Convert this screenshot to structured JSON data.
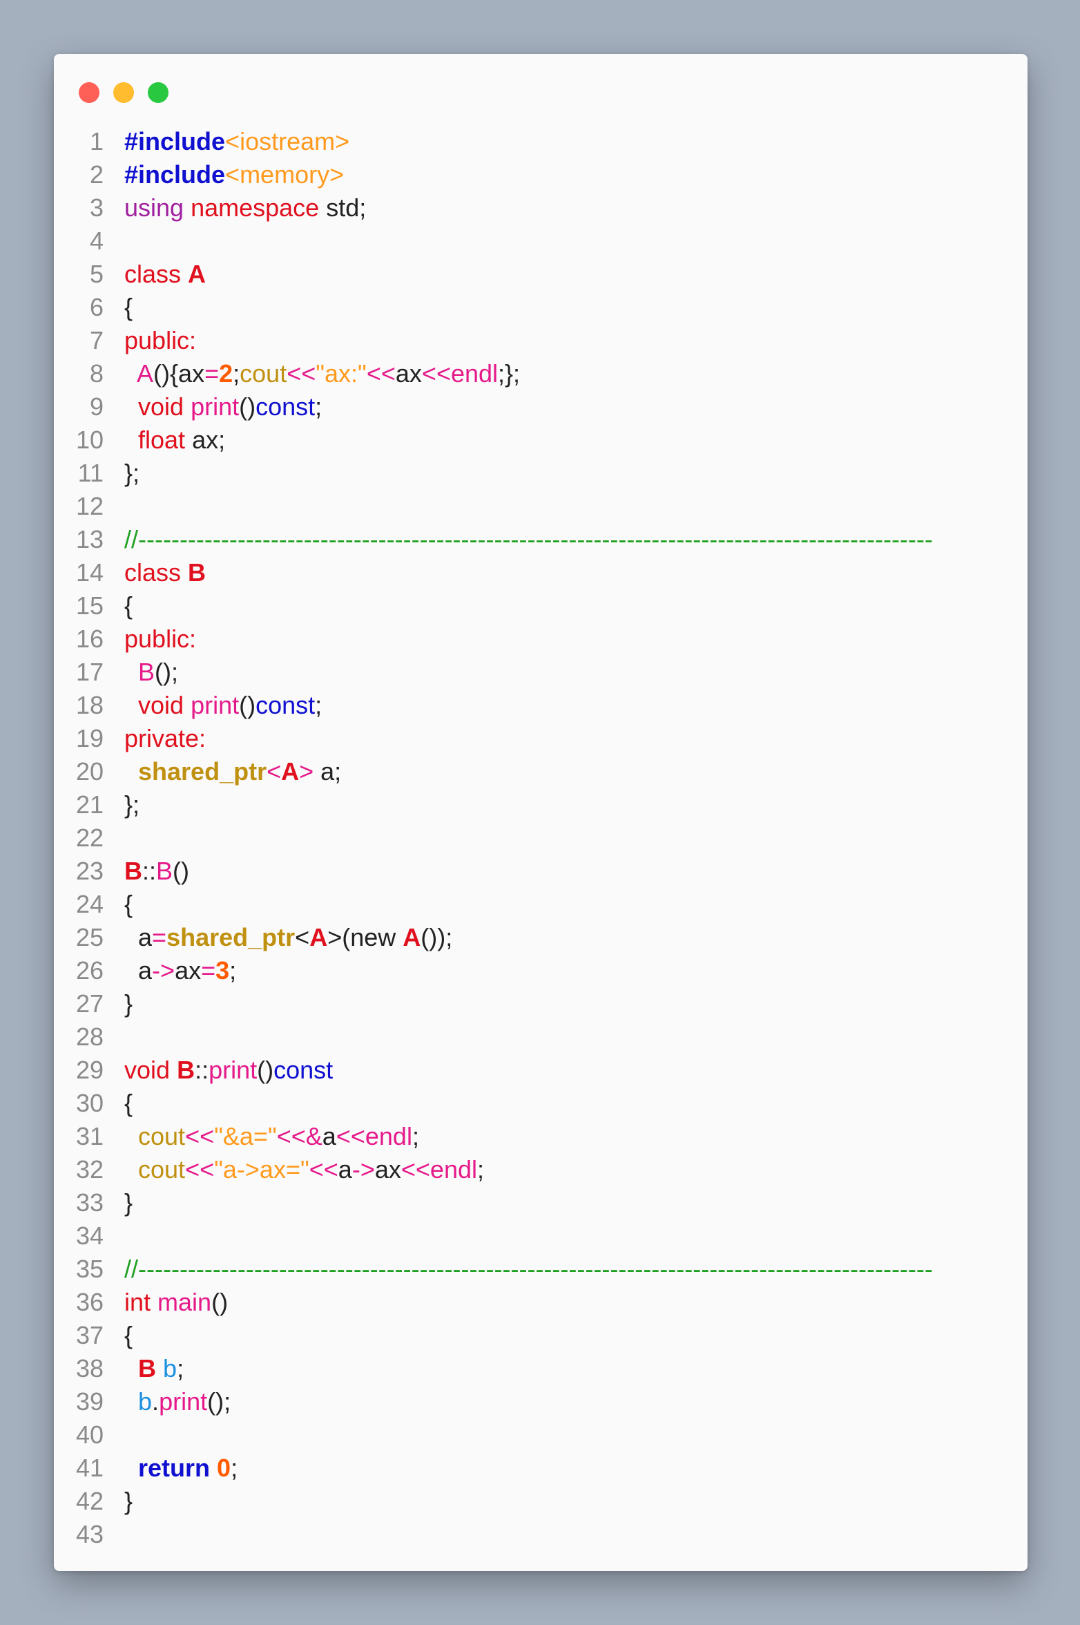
{
  "window": {
    "controls": [
      {
        "name": "close-button",
        "color": "#fe5f57"
      },
      {
        "name": "minimize-button",
        "color": "#febc2e"
      },
      {
        "name": "maximize-button",
        "color": "#28c840"
      }
    ]
  },
  "code": {
    "lines": [
      [
        [
          "#include",
          "#1010d0",
          1
        ],
        [
          "<iostream>",
          "#ff9a1e",
          0
        ]
      ],
      [
        [
          "#include",
          "#1010d0",
          1
        ],
        [
          "<memory>",
          "#ff9a1e",
          0
        ]
      ],
      [
        [
          "using",
          "#a0209f",
          0
        ],
        [
          " ",
          "#222222",
          0
        ],
        [
          "namespace",
          "#e0101e",
          0
        ],
        [
          " std;",
          "#222222",
          0
        ]
      ],
      [],
      [
        [
          "class",
          "#e0101e",
          0
        ],
        [
          " ",
          "#222222",
          0
        ],
        [
          "A",
          "#e0101e",
          1
        ]
      ],
      [
        [
          "{",
          "#222222",
          0
        ]
      ],
      [
        [
          "public:",
          "#e0101e",
          0
        ]
      ],
      [
        [
          "  ",
          "#222222",
          0
        ],
        [
          "A",
          "#e51a8a",
          0
        ],
        [
          "(){ax",
          "#222222",
          0
        ],
        [
          "=",
          "#e51a8a",
          0
        ],
        [
          "2",
          "#ff5a00",
          1
        ],
        [
          ";",
          "#222222",
          0
        ],
        [
          "cout",
          "#c09010",
          0
        ],
        [
          "<<",
          "#e51a8a",
          0
        ],
        [
          "\"ax:\"",
          "#ff9a1e",
          0
        ],
        [
          "<<",
          "#e51a8a",
          0
        ],
        [
          "ax",
          "#222222",
          0
        ],
        [
          "<<",
          "#e51a8a",
          0
        ],
        [
          "endl",
          "#e51a8a",
          0
        ],
        [
          ";};",
          "#222222",
          0
        ]
      ],
      [
        [
          "  ",
          "#222222",
          0
        ],
        [
          "void",
          "#e0101e",
          0
        ],
        [
          " ",
          "#222222",
          0
        ],
        [
          "print",
          "#e51a8a",
          0
        ],
        [
          "()",
          "#222222",
          0
        ],
        [
          "const",
          "#1010d0",
          0
        ],
        [
          ";",
          "#222222",
          0
        ]
      ],
      [
        [
          "  ",
          "#222222",
          0
        ],
        [
          "float",
          "#e0101e",
          0
        ],
        [
          " ax;",
          "#222222",
          0
        ]
      ],
      [
        [
          "};",
          "#222222",
          0
        ]
      ],
      [],
      [
        [
          "//------------------------------------------------------------------------------------------------",
          "#20a020",
          0
        ]
      ],
      [
        [
          "class",
          "#e0101e",
          0
        ],
        [
          " ",
          "#222222",
          0
        ],
        [
          "B",
          "#e0101e",
          1
        ]
      ],
      [
        [
          "{",
          "#222222",
          0
        ]
      ],
      [
        [
          "public:",
          "#e0101e",
          0
        ]
      ],
      [
        [
          "  ",
          "#222222",
          0
        ],
        [
          "B",
          "#e51a8a",
          0
        ],
        [
          "();",
          "#222222",
          0
        ]
      ],
      [
        [
          "  ",
          "#222222",
          0
        ],
        [
          "void",
          "#e0101e",
          0
        ],
        [
          " ",
          "#222222",
          0
        ],
        [
          "print",
          "#e51a8a",
          0
        ],
        [
          "()",
          "#222222",
          0
        ],
        [
          "const",
          "#1010d0",
          0
        ],
        [
          ";",
          "#222222",
          0
        ]
      ],
      [
        [
          "private:",
          "#e0101e",
          0
        ]
      ],
      [
        [
          "  ",
          "#222222",
          0
        ],
        [
          "shared_ptr",
          "#c09010",
          1
        ],
        [
          "<",
          "#e51a8a",
          0
        ],
        [
          "A",
          "#e0101e",
          1
        ],
        [
          ">",
          "#e51a8a",
          0
        ],
        [
          " a;",
          "#222222",
          0
        ]
      ],
      [
        [
          "};",
          "#222222",
          0
        ]
      ],
      [],
      [
        [
          "B",
          "#e0101e",
          1
        ],
        [
          "::",
          "#222222",
          0
        ],
        [
          "B",
          "#e51a8a",
          0
        ],
        [
          "()",
          "#222222",
          0
        ]
      ],
      [
        [
          "{",
          "#222222",
          0
        ]
      ],
      [
        [
          "  ",
          "#222222",
          0
        ],
        [
          "a",
          "#222222",
          0
        ],
        [
          "=",
          "#e51a8a",
          0
        ],
        [
          "shared_ptr",
          "#c09010",
          1
        ],
        [
          "<",
          "#222222",
          0
        ],
        [
          "A",
          "#e0101e",
          1
        ],
        [
          ">(new ",
          "#222222",
          0
        ],
        [
          "A",
          "#e0101e",
          1
        ],
        [
          "());",
          "#222222",
          0
        ]
      ],
      [
        [
          "  ",
          "#222222",
          0
        ],
        [
          "a",
          "#222222",
          0
        ],
        [
          "->",
          "#e51a8a",
          0
        ],
        [
          "ax",
          "#222222",
          0
        ],
        [
          "=",
          "#e51a8a",
          0
        ],
        [
          "3",
          "#ff5a00",
          1
        ],
        [
          ";",
          "#222222",
          0
        ]
      ],
      [
        [
          "}",
          "#222222",
          0
        ]
      ],
      [],
      [
        [
          "void",
          "#e0101e",
          0
        ],
        [
          " ",
          "#222222",
          0
        ],
        [
          "B",
          "#e0101e",
          1
        ],
        [
          "::",
          "#222222",
          0
        ],
        [
          "print",
          "#e51a8a",
          0
        ],
        [
          "()",
          "#222222",
          0
        ],
        [
          "const",
          "#1010d0",
          0
        ]
      ],
      [
        [
          "{",
          "#222222",
          0
        ]
      ],
      [
        [
          "  ",
          "#222222",
          0
        ],
        [
          "cout",
          "#c09010",
          0
        ],
        [
          "<<",
          "#e51a8a",
          0
        ],
        [
          "\"&a=\"",
          "#ff9a1e",
          0
        ],
        [
          "<<",
          "#e51a8a",
          0
        ],
        [
          "&",
          "#e51a8a",
          0
        ],
        [
          "a",
          "#222222",
          0
        ],
        [
          "<<",
          "#e51a8a",
          0
        ],
        [
          "endl",
          "#e51a8a",
          0
        ],
        [
          ";",
          "#222222",
          0
        ]
      ],
      [
        [
          "  ",
          "#222222",
          0
        ],
        [
          "cout",
          "#c09010",
          0
        ],
        [
          "<<",
          "#e51a8a",
          0
        ],
        [
          "\"a->ax=\"",
          "#ff9a1e",
          0
        ],
        [
          "<<",
          "#e51a8a",
          0
        ],
        [
          "a",
          "#222222",
          0
        ],
        [
          "->",
          "#e51a8a",
          0
        ],
        [
          "ax",
          "#222222",
          0
        ],
        [
          "<<",
          "#e51a8a",
          0
        ],
        [
          "endl",
          "#e51a8a",
          0
        ],
        [
          ";",
          "#222222",
          0
        ]
      ],
      [
        [
          "}",
          "#222222",
          0
        ]
      ],
      [],
      [
        [
          "//------------------------------------------------------------------------------------------------",
          "#20a020",
          0
        ]
      ],
      [
        [
          "int",
          "#e0101e",
          0
        ],
        [
          " ",
          "#222222",
          0
        ],
        [
          "main",
          "#e51a8a",
          0
        ],
        [
          "()",
          "#222222",
          0
        ]
      ],
      [
        [
          "{",
          "#222222",
          0
        ]
      ],
      [
        [
          "  ",
          "#222222",
          0
        ],
        [
          "B",
          "#e0101e",
          1
        ],
        [
          " ",
          "#222222",
          0
        ],
        [
          "b",
          "#1e90e0",
          0
        ],
        [
          ";",
          "#222222",
          0
        ]
      ],
      [
        [
          "  ",
          "#222222",
          0
        ],
        [
          "b",
          "#1e90e0",
          0
        ],
        [
          ".",
          "#222222",
          0
        ],
        [
          "print",
          "#e51a8a",
          0
        ],
        [
          "();",
          "#222222",
          0
        ]
      ],
      [],
      [
        [
          "  ",
          "#222222",
          0
        ],
        [
          "return",
          "#1010d0",
          1
        ],
        [
          " ",
          "#222222",
          0
        ],
        [
          "0",
          "#ff5a00",
          1
        ],
        [
          ";",
          "#222222",
          0
        ]
      ],
      [
        [
          "}",
          "#222222",
          0
        ]
      ],
      []
    ]
  }
}
